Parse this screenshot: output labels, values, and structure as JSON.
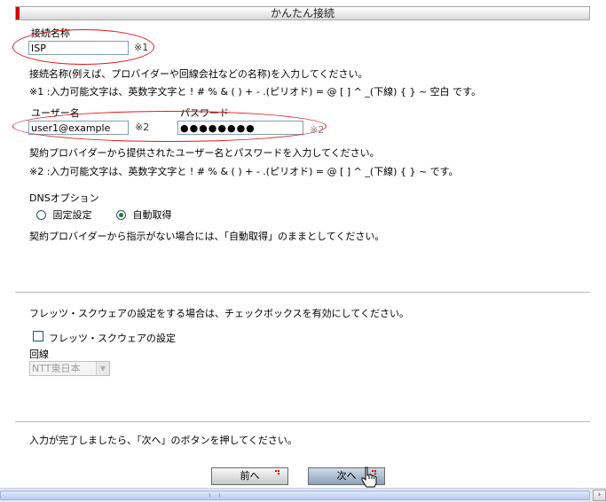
{
  "header": {
    "title": "かんたん接続"
  },
  "connection": {
    "name_label": "接続名称",
    "name_value": "ISP",
    "name_mark": "※1",
    "help1": "接続名称(例えば、プロバイダーや回線会社などの名称)を入力してください。",
    "note1": "※1 :入力可能文字は、英数字文字と ! # % & ( ) + - .(ピリオド) = @ [ ] ^ _(下線) { } ~ 空白 です。"
  },
  "account": {
    "user_label": "ユーザー名",
    "user_value": "user1@example",
    "user_mark": "※2",
    "password_label": "パスワード",
    "password_value": "●●●●●●●●",
    "password_mark": "※2",
    "help2": "契約プロバイダーから提供されたユーザー名とパスワードを入力してください。",
    "note2": "※2 :入力可能文字は、英数字文字と ! # % & ( ) + - .(ピリオド) = @ [ ] ^ _(下線) { } ~ です。"
  },
  "dns": {
    "label": "DNSオプション",
    "options": [
      "固定設定",
      "自動取得"
    ],
    "selected": "自動取得",
    "help": "契約プロバイダーから指示がない場合には、「自動取得」のままとしてください。"
  },
  "flets": {
    "instruction": "フレッツ・スクウェアの設定をする場合は、チェックボックスを有効にしてください。",
    "checkbox_label": "フレッツ・スクウェアの設定",
    "checked": false,
    "line_label": "回線",
    "line_value": "NTT東日本"
  },
  "footer": {
    "instruction": "入力が完了しましたら、「次へ」のボタンを押してください。",
    "prev_label": "前へ",
    "next_label": "次へ"
  },
  "colors": {
    "accent": "#d40000",
    "highlight_ellipse": "#e01818",
    "radio_selected": "#2a7a2a"
  }
}
